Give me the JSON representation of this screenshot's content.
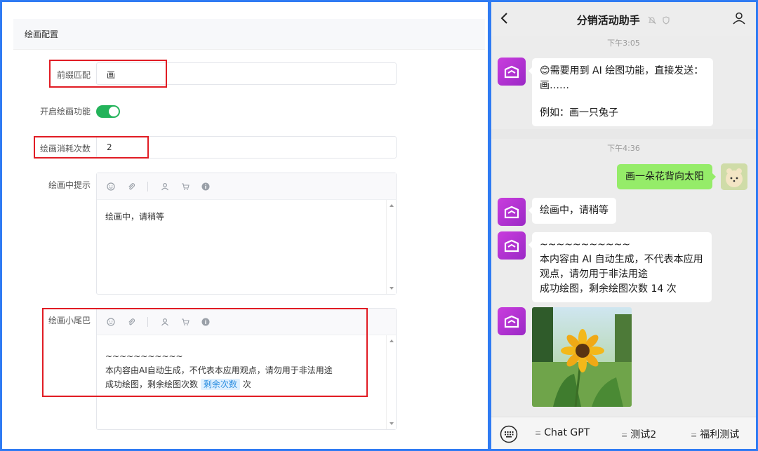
{
  "settings": {
    "section_title": "绘画配置",
    "prefix_label": "前缀匹配",
    "prefix_value": "画",
    "enable_label": "开启绘画功能",
    "enable_on": true,
    "cost_label": "绘画消耗次数",
    "cost_value": "2",
    "drawing_tip_label": "绘画中提示",
    "drawing_tip_text": "绘画中，请稍等",
    "tail_label": "绘画小尾巴",
    "tail_line1": "~~~~~~~~~~~",
    "tail_line2": "本内容由AI自动生成，不代表本应用观点，请勿用于非法用途",
    "tail_line3_prefix": "成功绘图，剩余绘图次数",
    "tail_variable": "剩余次数",
    "tail_line3_suffix": "次",
    "toolbar_icons": [
      "smile-icon",
      "paperclip-icon",
      "user-icon",
      "cart-icon",
      "info-icon"
    ]
  },
  "chat": {
    "title": "分销活动助手",
    "back_icon": "chevron-left-icon",
    "mute_icon": "bell-off-icon",
    "shield_icon": "shield-icon",
    "profile_icon": "person-icon",
    "time1": "下午3:05",
    "msg1_line1": "😊需要用到 AI 绘图功能，直接发送：画……",
    "msg1_line2": "例如：画一只兔子",
    "time2": "下午4:36",
    "user_msg": "画一朵花背向太阳",
    "msg2": "绘画中，请稍等",
    "msg3_line1": "~~~~~~~~~~~",
    "msg3_line2": "本内容由 AI 自动生成，不代表本应用观点，请勿用于非法用途",
    "msg3_line3": "成功绘图，剩余绘图次数 14 次",
    "image_desc": "sunflower-image",
    "keyboard_icon": "keyboard-icon",
    "menu": [
      "Chat GPT",
      "测试2",
      "福利测试"
    ]
  },
  "colors": {
    "frame": "#2f7bf3",
    "highlight": "#e11c24",
    "toggle_on": "#23b35a",
    "user_bubble": "#95ec69",
    "bot_avatar": "#b534d4",
    "variable_chip": "#2a8de0"
  }
}
